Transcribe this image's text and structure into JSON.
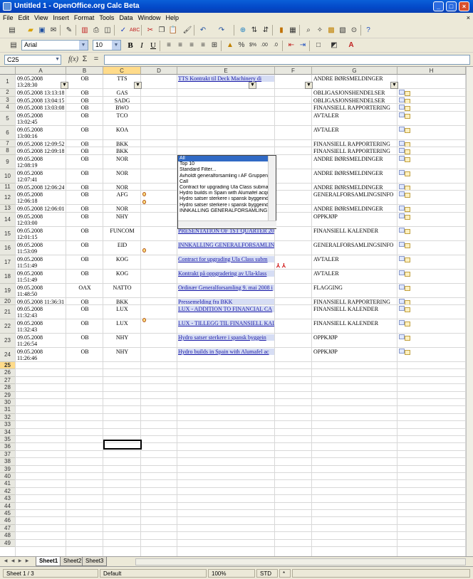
{
  "window": {
    "title": "Untitled 1 - OpenOffice.org Calc Beta"
  },
  "menu": [
    "File",
    "Edit",
    "View",
    "Insert",
    "Format",
    "Tools",
    "Data",
    "Window",
    "Help"
  ],
  "formatting": {
    "font_name": "Arial",
    "font_size": "10"
  },
  "formula_bar": {
    "cell_ref": "C25",
    "fx": "f(x)",
    "sum": "Σ",
    "equals": "=",
    "content": ""
  },
  "columns": [
    "A",
    "B",
    "C",
    "D",
    "E",
    "F",
    "G",
    "H"
  ],
  "selected_column": "C",
  "selected_row": "25",
  "rows": [
    {
      "n": "1",
      "date": "09.05.2008 13:28:30",
      "market": "OB",
      "ticker": "TTS",
      "title": "TTS Kontrakt til Deck Machinery di",
      "category": "ANDRE BØRSMELDINGER"
    },
    {
      "n": "2",
      "date": "09.05.2008 13:13:18",
      "market": "OB",
      "ticker": "GAS",
      "title": "",
      "category": "OBLIGASJONSHENDELSER"
    },
    {
      "n": "3",
      "date": "09.05.2008 13:04:15",
      "market": "OB",
      "ticker": "SADG",
      "title": "",
      "category": "OBLIGASJONSHENDELSER"
    },
    {
      "n": "4",
      "date": "09.05.2008 13:03:08",
      "market": "OB",
      "ticker": "BWO",
      "title": "",
      "category": "FINANSIELL RAPPORTERING"
    },
    {
      "n": "5",
      "date": "09.05.2008 13:02:45",
      "market": "OB",
      "ticker": "TCO",
      "title": "",
      "category": "AVTALER"
    },
    {
      "n": "6",
      "date": "09.05.2008 13:00:16",
      "market": "OB",
      "ticker": "KOA",
      "title": "",
      "category": "AVTALER"
    },
    {
      "n": "7",
      "date": "09.05.2008 12:09:52",
      "market": "OB",
      "ticker": "BKK",
      "title": "",
      "category": "FINANSIELL RAPPORTERING"
    },
    {
      "n": "8",
      "date": "09.05.2008 12:09:18",
      "market": "OB",
      "ticker": "BKK",
      "title": "",
      "category": "FINANSIELL RAPPORTERING"
    },
    {
      "n": "9",
      "date": "09.05.2008 12:08:19",
      "market": "OB",
      "ticker": "NOR",
      "title": "Term Sheet for reservebasert lånefasilit",
      "category": "ANDRE BØRSMELDINGER"
    },
    {
      "n": "10",
      "date": "09.05.2008 12:07:41",
      "market": "OB",
      "ticker": "NOR",
      "title": "Term sheet reserve based lending facili",
      "category": "ANDRE BØRSMELDINGER"
    },
    {
      "n": "11",
      "date": "09.05.2008 12:06:24",
      "market": "OB",
      "ticker": "NOR",
      "title": "Innløsning av obligasjonslån",
      "category": "ANDRE BØRSMELDINGER"
    },
    {
      "n": "12",
      "date": "09.05.2008 12:06:18",
      "market": "OB",
      "ticker": "AFG",
      "title": "Avholdt generalforsamling i AF Gruppe",
      "category": "GENERALFORSAMLINGSINFO"
    },
    {
      "n": "13",
      "date": "09.05.2008 12:06:01",
      "market": "OB",
      "ticker": "NOR",
      "title": "Repayment of bond",
      "category": "ANDRE BØRSMELDINGER"
    },
    {
      "n": "14",
      "date": "09.05.2008 12:03:00",
      "market": "OB",
      "ticker": "NHY",
      "title": "Hydro satser sterkere i spansk byggein",
      "category": "OPPKJØP"
    },
    {
      "n": "15",
      "date": "09.05.2008 12:01:15",
      "market": "OB",
      "ticker": "FUNCOM",
      "title": "PRESENTATION OF 1ST QUARTER 20",
      "category": "FINANSIELL KALENDER"
    },
    {
      "n": "16",
      "date": "09.05.2008 11:53:09",
      "market": "OB",
      "ticker": "EID",
      "title": "INNKALLING GENERALFORSAMLIN",
      "category": "GENERALFORSAMLINGSINFO"
    },
    {
      "n": "17",
      "date": "09.05.2008 11:51:49",
      "market": "OB",
      "ticker": "KOG",
      "title": "Contract for upgrading Ula Class subm",
      "category": "AVTALER"
    },
    {
      "n": "18",
      "date": "09.05.2008 11:51:49",
      "market": "OB",
      "ticker": "KOG",
      "title": "Kontrakt på oppgradering av Ula-klass",
      "category": "AVTALER"
    },
    {
      "n": "19",
      "date": "09.05.2008 11:48:50",
      "market": "OAX",
      "ticker": "NATTO",
      "title": "Ordinær Generalforsamling 9. mai 2008 i",
      "category": "FLAGGING"
    },
    {
      "n": "20",
      "date": "09.05.2008 11:36:31",
      "market": "OB",
      "ticker": "BKK",
      "title": "Pressemelding fra BKK",
      "category": "FINANSIELL RAPPORTERING"
    },
    {
      "n": "21",
      "date": "09.05.2008 11:32:43",
      "market": "OB",
      "ticker": "LUX",
      "title": "LUX - ADDITION TO FINANCIAL CA",
      "category": "FINANSIELL KALENDER"
    },
    {
      "n": "22",
      "date": "09.05.2008 11:32:43",
      "market": "OB",
      "ticker": "LUX",
      "title": "LUX - TILLEGG TIL FINANSIELL KAL",
      "category": "FINANSIELL KALENDER"
    },
    {
      "n": "23",
      "date": "09.05.2008 11:26:54",
      "market": "OB",
      "ticker": "NHY",
      "title": "Hydro satser sterkere i spansk byggein",
      "category": "OPPKJØP"
    },
    {
      "n": "24",
      "date": "09.05.2008 11:26:46",
      "market": "OB",
      "ticker": "NHY",
      "title": "Hydro builds in Spain with Alumafel ac",
      "category": "OPPKJØP"
    }
  ],
  "empty_rows": [
    "25",
    "26",
    "27",
    "28",
    "29",
    "30",
    "31",
    "32",
    "33",
    "34",
    "35",
    "36",
    "37",
    "38",
    "39",
    "40",
    "41",
    "42",
    "43",
    "44",
    "45",
    "46",
    "47",
    "48",
    "49"
  ],
  "autofilter_dropdown": [
    "All",
    "Top 10",
    "Standard Filter...",
    "Avholdt generalforsamling i AF Gruppen",
    "Call",
    "Contract for upgrading Ula Class submar",
    "Hydro builds in Spain with Alumafel acqui",
    "Hydro satser sterkere i spansk byggeind",
    "Hydro satser sterkere i spansk byggeind",
    "INNKALLING GENERALFORSAMLING"
  ],
  "sheet_tabs": [
    "Sheet1",
    "Sheet2",
    "Sheet3"
  ],
  "active_sheet": "Sheet1",
  "status": {
    "sheet": "Sheet 1 / 3",
    "style": "Default",
    "zoom": "100%",
    "mode": "STD",
    "modified": "*"
  }
}
